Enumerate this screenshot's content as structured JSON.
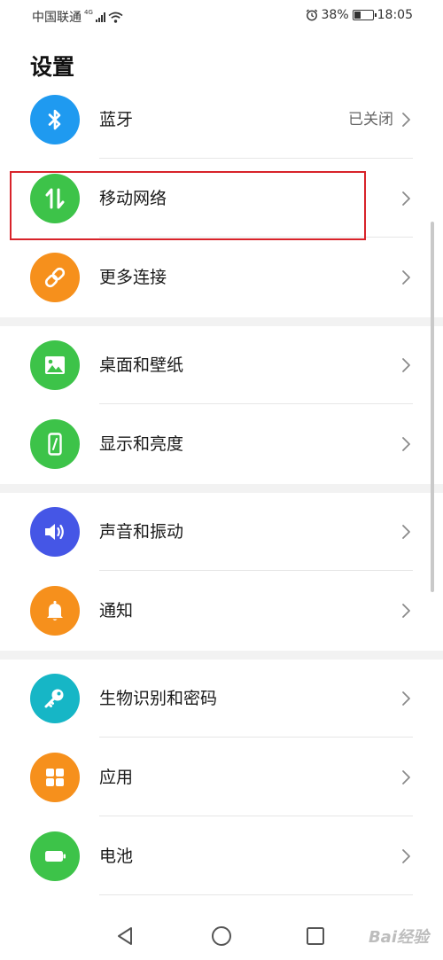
{
  "status_bar": {
    "carrier": "中国联通",
    "network": "4G",
    "battery": "38%",
    "battery_level": 0.38,
    "time": "18:05"
  },
  "page_title": "设置",
  "groups": [
    [
      {
        "id": "bluetooth",
        "label": "蓝牙",
        "value": "已关闭",
        "icon": "bluetooth-icon",
        "color": "#1f9af0"
      },
      {
        "id": "mobile-network",
        "label": "移动网络",
        "value": "",
        "icon": "mobile-data-arrows-icon",
        "color": "#3dc349",
        "highlighted": true
      },
      {
        "id": "more-connections",
        "label": "更多连接",
        "value": "",
        "icon": "link-icon",
        "color": "#f6901c"
      }
    ],
    [
      {
        "id": "wallpaper",
        "label": "桌面和壁纸",
        "value": "",
        "icon": "image-icon",
        "color": "#3dc349"
      },
      {
        "id": "display",
        "label": "显示和亮度",
        "value": "",
        "icon": "phone-brightness-icon",
        "color": "#3dc349"
      }
    ],
    [
      {
        "id": "sound",
        "label": "声音和振动",
        "value": "",
        "icon": "speaker-icon",
        "color": "#4556e6"
      },
      {
        "id": "notifications",
        "label": "通知",
        "value": "",
        "icon": "bell-icon",
        "color": "#f6901c"
      }
    ],
    [
      {
        "id": "biometrics",
        "label": "生物识别和密码",
        "value": "",
        "icon": "key-icon",
        "color": "#16b6c6"
      },
      {
        "id": "apps",
        "label": "应用",
        "value": "",
        "icon": "apps-grid-icon",
        "color": "#f6901c"
      },
      {
        "id": "battery",
        "label": "电池",
        "value": "",
        "icon": "battery-icon",
        "color": "#3dc349"
      }
    ]
  ],
  "nav": [
    "back-icon",
    "home-icon",
    "recents-icon"
  ],
  "watermark": "Bai经验"
}
